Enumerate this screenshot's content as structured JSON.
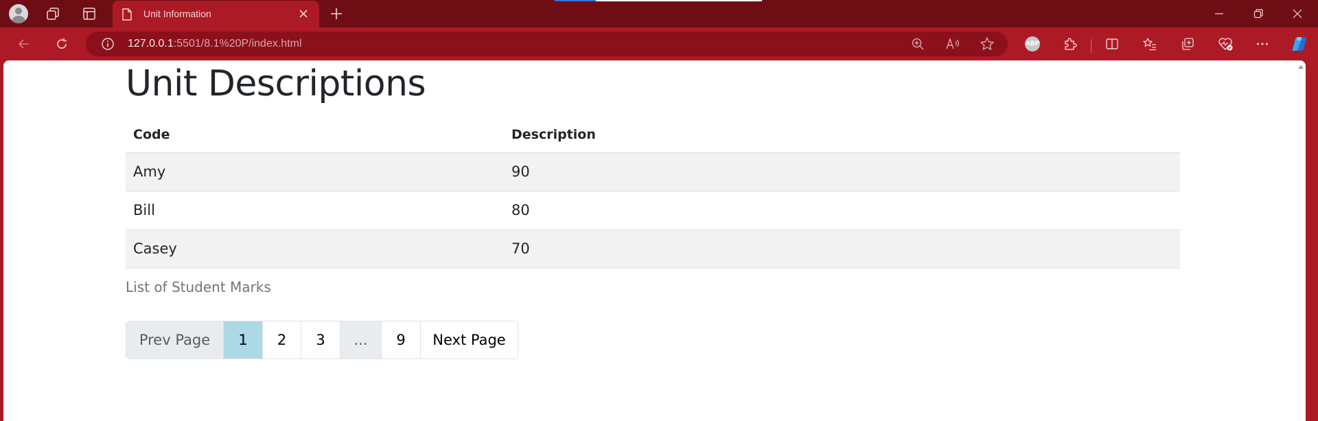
{
  "browser": {
    "tab": {
      "title": "Unit Information"
    },
    "url": {
      "host": "127.0.0.1",
      "path": ":5501/8.1%20P/index.html"
    },
    "colors": {
      "frame": "#ac1a25",
      "tabstrip": "#6f0d15",
      "addressbar": "#8b101b"
    }
  },
  "page": {
    "heading": "Unit Descriptions",
    "table": {
      "headers": [
        "Code",
        "Description"
      ],
      "rows": [
        [
          "Amy",
          "90"
        ],
        [
          "Bill",
          "80"
        ],
        [
          "Casey",
          "70"
        ]
      ]
    },
    "caption": "List of Student Marks",
    "pagination": {
      "prev": "Prev Page",
      "pages": [
        "1",
        "2",
        "3"
      ],
      "ellipsis": "...",
      "last": "9",
      "next": "Next Page",
      "active_page": "1",
      "active_color": "#add8e6"
    }
  }
}
